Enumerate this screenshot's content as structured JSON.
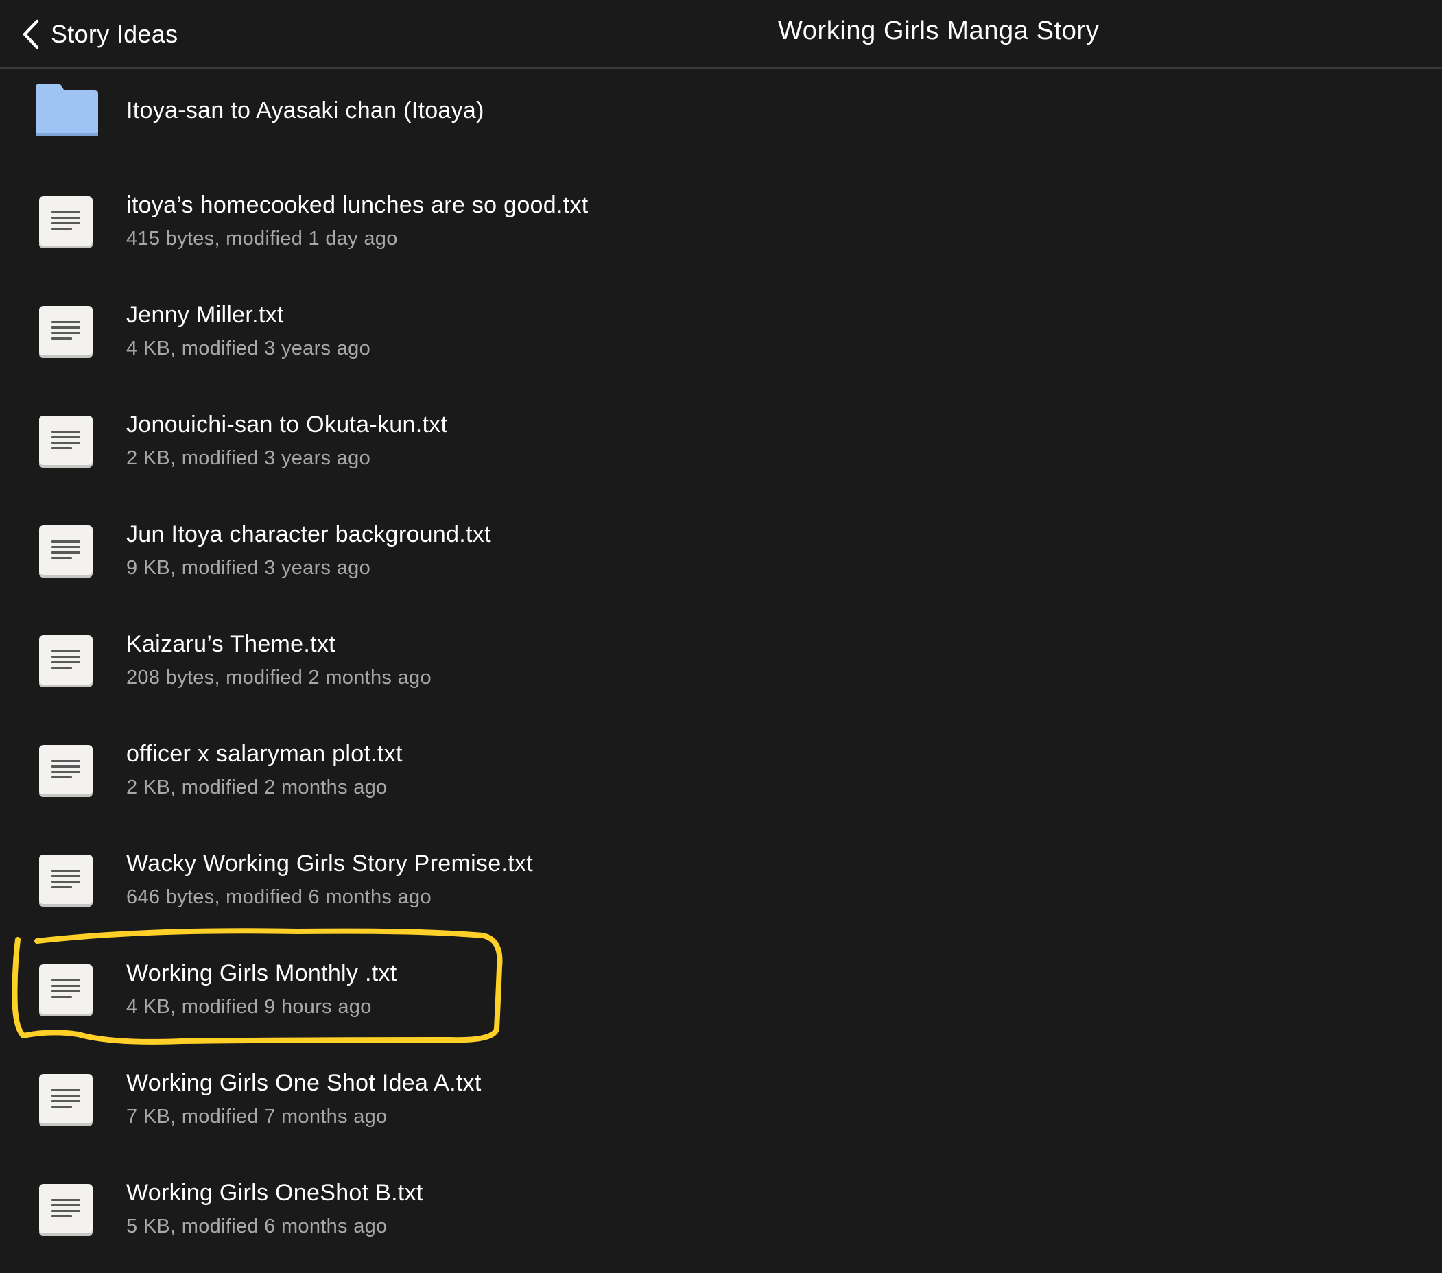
{
  "nav": {
    "back_label": "Story Ideas",
    "title": "Working Girls Manga Story"
  },
  "folder": {
    "name": "Itoya-san to Ayasaki chan (Itoaya)",
    "icon": "folder-icon",
    "color": "#9fc4f4"
  },
  "files": [
    {
      "name": "itoya’s homecooked lunches are so good.txt",
      "meta": "415 bytes, modified 1 day ago"
    },
    {
      "name": "Jenny Miller.txt",
      "meta": "4 KB, modified 3 years ago"
    },
    {
      "name": "Jonouichi-san to Okuta-kun.txt",
      "meta": "2 KB, modified 3 years ago"
    },
    {
      "name": "Jun Itoya character background.txt",
      "meta": "9 KB, modified 3 years ago"
    },
    {
      "name": "Kaizaru’s Theme.txt",
      "meta": "208 bytes, modified 2 months ago"
    },
    {
      "name": "officer x salaryman plot.txt",
      "meta": "2 KB, modified 2 months ago"
    },
    {
      "name": "Wacky Working Girls Story Premise.txt",
      "meta": "646 bytes, modified 6 months ago"
    },
    {
      "name": "Working Girls Monthly .txt",
      "meta": "4 KB, modified 9 hours ago"
    },
    {
      "name": "Working Girls One Shot Idea A.txt",
      "meta": "7 KB, modified 7 months ago"
    },
    {
      "name": "Working Girls OneShot B.txt",
      "meta": "5 KB, modified 6 months ago"
    }
  ],
  "highlight_color": "#ffd028",
  "icons": {
    "back": "chevron-left-icon",
    "file": "text-file-icon"
  }
}
